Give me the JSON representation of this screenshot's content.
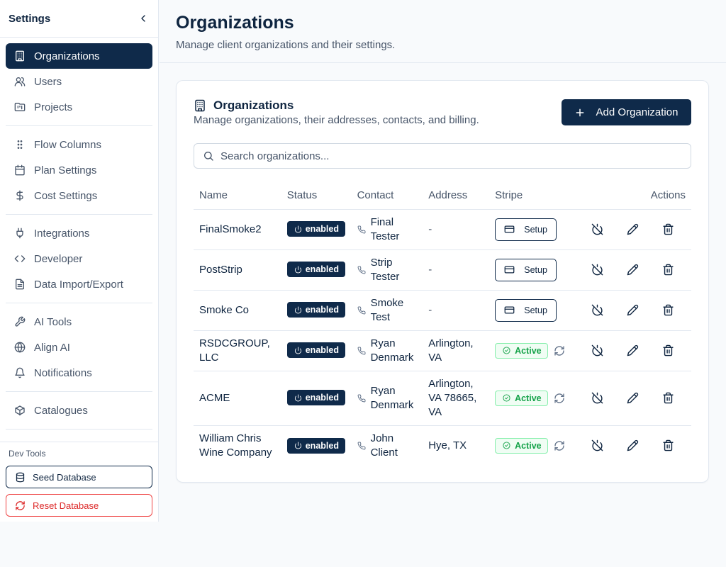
{
  "sidebar": {
    "title": "Settings",
    "groups": [
      [
        {
          "label": "Organizations",
          "icon": "building-icon",
          "active": true
        },
        {
          "label": "Users",
          "icon": "users-icon"
        },
        {
          "label": "Projects",
          "icon": "folder-kanban-icon"
        }
      ],
      [
        {
          "label": "Flow Columns",
          "icon": "grip-icon"
        },
        {
          "label": "Plan Settings",
          "icon": "calendar-icon"
        },
        {
          "label": "Cost Settings",
          "icon": "dollar-icon"
        }
      ],
      [
        {
          "label": "Integrations",
          "icon": "plug-icon"
        },
        {
          "label": "Developer",
          "icon": "code-icon"
        },
        {
          "label": "Data Import/Export",
          "icon": "file-icon"
        }
      ],
      [
        {
          "label": "AI Tools",
          "icon": "wrench-icon"
        },
        {
          "label": "Align AI",
          "icon": "globe-icon"
        },
        {
          "label": "Notifications",
          "icon": "bell-icon"
        }
      ],
      [
        {
          "label": "Catalogues",
          "icon": "package-icon"
        }
      ]
    ],
    "dev_tools": {
      "label": "Dev Tools",
      "seed_label": "Seed Database",
      "reset_label": "Reset Database"
    }
  },
  "page": {
    "title": "Organizations",
    "subtitle": "Manage client organizations and their settings."
  },
  "card": {
    "title": "Organizations",
    "description": "Manage organizations, their addresses, contacts, and billing.",
    "add_label": "Add Organization",
    "search_placeholder": "Search organizations..."
  },
  "table": {
    "columns": [
      "Name",
      "Status",
      "Contact",
      "Address",
      "Stripe",
      "Actions"
    ],
    "rows": [
      {
        "name": [
          "FinalSmoke2"
        ],
        "status": "enabled",
        "contact": [
          "Final",
          "Tester"
        ],
        "address": [
          "-"
        ],
        "stripe": "Setup"
      },
      {
        "name": [
          "PostStrip"
        ],
        "status": "enabled",
        "contact": [
          "Strip",
          "Tester"
        ],
        "address": [
          "-"
        ],
        "stripe": "Setup"
      },
      {
        "name": [
          "Smoke Co"
        ],
        "status": "enabled",
        "contact": [
          "Smoke",
          "Test"
        ],
        "address": [
          "-"
        ],
        "stripe": "Setup"
      },
      {
        "name": [
          "RSDCGROUP,",
          "LLC"
        ],
        "status": "enabled",
        "contact": [
          "Ryan",
          "Denmark"
        ],
        "address": [
          "Arlington,",
          "VA"
        ],
        "stripe": "Active"
      },
      {
        "name": [
          "ACME"
        ],
        "status": "enabled",
        "contact": [
          "Ryan",
          "Denmark"
        ],
        "address": [
          "Arlington,",
          "VA 78665,",
          "VA"
        ],
        "stripe": "Active"
      },
      {
        "name": [
          "William Chris",
          "Wine Company"
        ],
        "status": "enabled",
        "contact": [
          "John",
          "Client"
        ],
        "address": [
          "Hye, TX"
        ],
        "stripe": "Active"
      }
    ]
  },
  "colors": {
    "primary": "#0f2a4a",
    "danger": "#dc2626",
    "success": "#16a34a",
    "muted_text": "#475569"
  }
}
